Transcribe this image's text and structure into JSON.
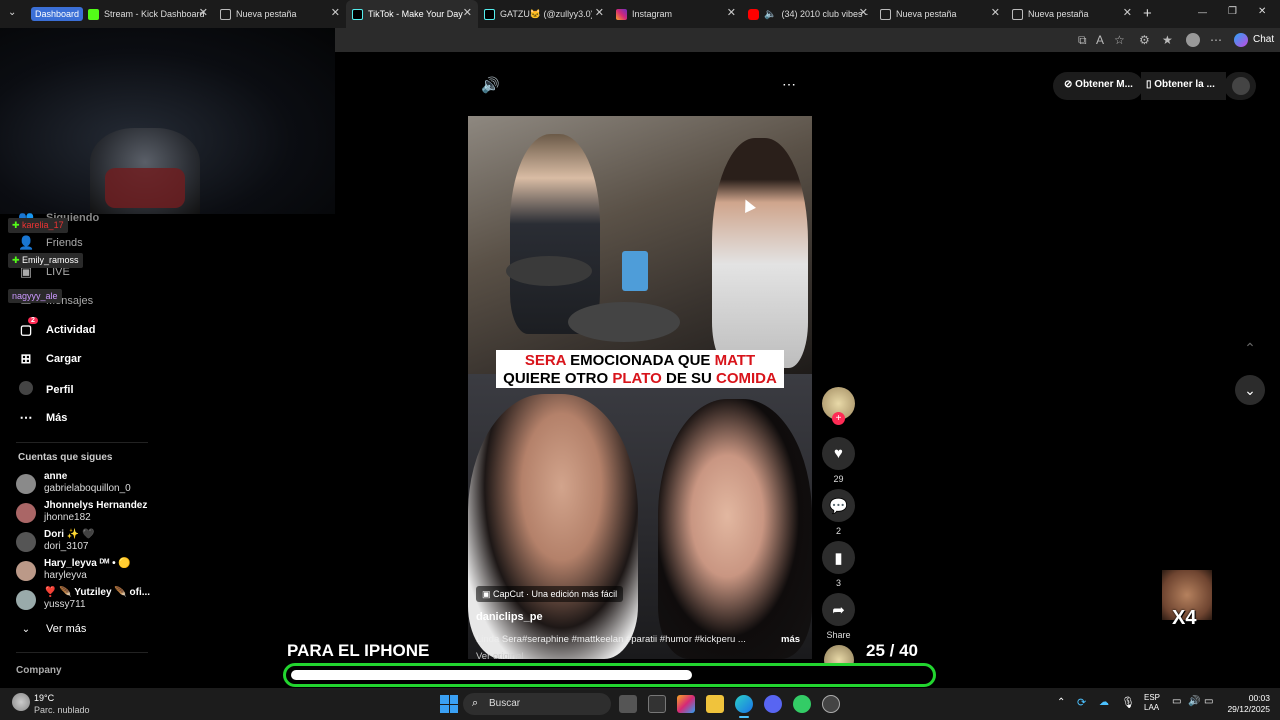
{
  "browser": {
    "tabs": [
      {
        "label": "Dashboard",
        "badge": true
      },
      {
        "label": "Stream - Kick Dashboard"
      },
      {
        "label": "Nueva pestaña"
      },
      {
        "label": "TikTok - Make Your Day",
        "active": true
      },
      {
        "label": "GATZU🐱 (@zullyy3.0) es"
      },
      {
        "label": "Instagram"
      },
      {
        "label": "(34) 2010 club vibes -"
      },
      {
        "label": "Nueva pestaña"
      },
      {
        "label": "Nueva pestaña"
      }
    ],
    "new_tab": "+",
    "window_controls": {
      "minimize": "—",
      "restore": "❐",
      "close": "✕"
    },
    "copilot_label": "Chat"
  },
  "stream_overlay": {
    "chat_names": [
      "karelia_17",
      "Emily_ramoss",
      "nagyyy_ale"
    ],
    "overlay_title": "PARA EL IPHONE",
    "counter_current": "25",
    "counter_total": "/ 40",
    "progress": 0.63,
    "multiplier": "X4"
  },
  "sidebar": {
    "top_items": [
      {
        "label": "Siguiendo"
      },
      {
        "label": "Friends"
      },
      {
        "label": "LIVE"
      },
      {
        "label": "Mensajes"
      }
    ],
    "nav": [
      {
        "label": "Actividad",
        "icon": "activity-icon",
        "badge": "2"
      },
      {
        "label": "Cargar",
        "icon": "upload-icon"
      },
      {
        "label": "Perfil",
        "icon": "profile-icon"
      },
      {
        "label": "Más",
        "icon": "more-icon"
      }
    ],
    "following_title": "Cuentas que sigues",
    "following": [
      {
        "name": "anne",
        "user": "gabrielaboquillon_0"
      },
      {
        "name": "Jhonnelys Hernandez",
        "user": "jhonne182"
      },
      {
        "name": "Dori ✨ 🖤",
        "user": "dori_3107"
      },
      {
        "name": "Hary_leyva ᴰᴹ • 🟡",
        "user": "haryleyva"
      },
      {
        "name": "❣️ 🪶 Yutziley 🪶 ofi...",
        "user": "yussy711"
      }
    ],
    "see_more": "Ver más",
    "company": "Company"
  },
  "player": {
    "caption_line1_a": "SERA",
    "caption_line1_b": " EMOCIONADA QUE ",
    "caption_line1_c": "MATT",
    "caption_line2_a": "QUIERE OTRO ",
    "caption_line2_b": "PLATO",
    "caption_line2_c": " DE SU ",
    "caption_line2_d": "COMIDA",
    "capcut": "CapCut · Una edición más fácil",
    "author": "daniclips_pe",
    "description": "Linda Sera#seraphine #mattkeelan #paratii #humor #kickperu ...",
    "more": "más",
    "original": "Ver original",
    "likes": "29",
    "comments": "2",
    "saves": "3",
    "share": "Share"
  },
  "top_right": {
    "get_app": "Obtener M...",
    "get_pc": "Obtener la ..."
  },
  "taskbar": {
    "weather_temp": "19°C",
    "weather_desc": "Parc. nublado",
    "search": "Buscar",
    "lang1": "ESP",
    "lang2": "LAA",
    "time": "00:03",
    "date": "29/12/2025"
  }
}
